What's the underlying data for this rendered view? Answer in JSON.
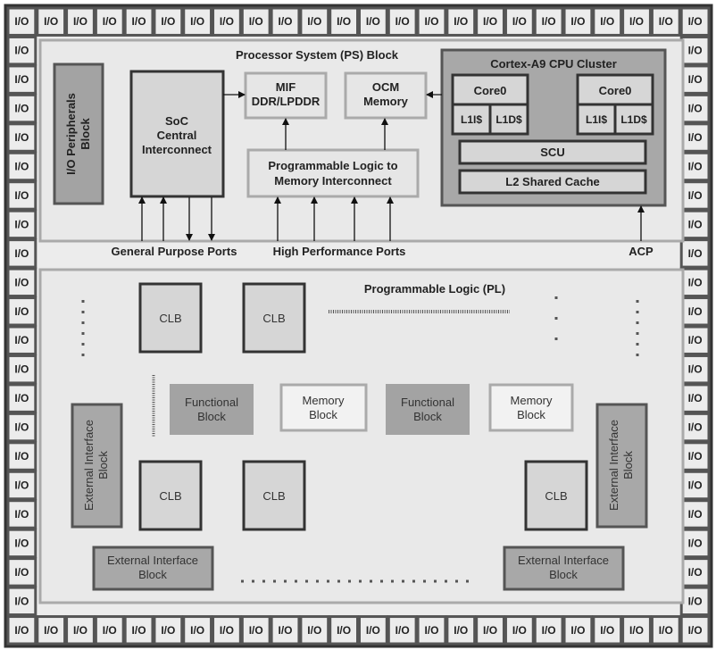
{
  "io": {
    "label": "I/O",
    "top_count": 24,
    "bottom_count": 24,
    "side_count": 20
  },
  "ps": {
    "title": "Processor System (PS) Block",
    "io_peripherals": [
      "I/O Peripherals",
      "Block"
    ],
    "soc": [
      "SoC",
      "Central",
      "Interconnect"
    ],
    "mif": [
      "MIF",
      "DDR/LPDDR"
    ],
    "ocm": [
      "OCM",
      "Memory"
    ],
    "pl_mem": [
      "Programmable Logic to",
      "Memory Interconnect"
    ],
    "cpu": {
      "title": "Cortex-A9 CPU Cluster",
      "cores": [
        {
          "name": "Core0",
          "l1i": "L1I$",
          "l1d": "L1D$"
        },
        {
          "name": "Core0",
          "l1i": "L1I$",
          "l1d": "L1D$"
        }
      ],
      "scu": "SCU",
      "l2": "L2 Shared Cache"
    },
    "ports": {
      "gp": "General Purpose Ports",
      "hp": "High Performance Ports",
      "acp": "ACP"
    }
  },
  "pl": {
    "title": "Programmable Logic (PL)",
    "clb": "CLB",
    "functional": [
      "Functional",
      "Block"
    ],
    "memory": [
      "Memory",
      "Block"
    ],
    "ext": [
      "External Interface",
      "Block"
    ]
  },
  "colors": {
    "dark_border": "#444444",
    "light_border": "#aaaaaa",
    "dark_fill": "#a3a3a3",
    "mid_fill": "#d6d6d6",
    "bg": "#e9e9e9"
  }
}
